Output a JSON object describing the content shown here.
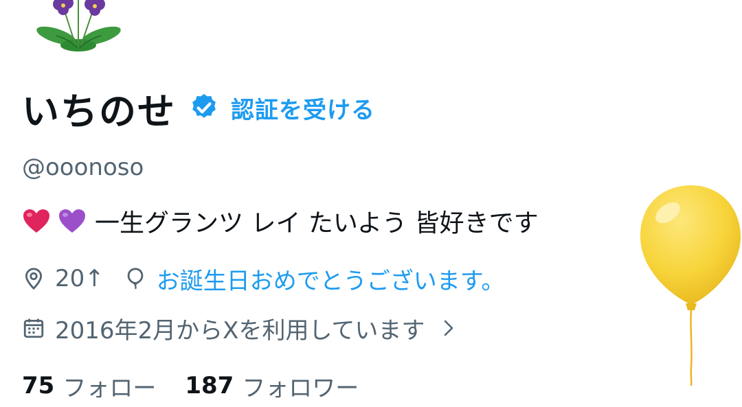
{
  "profile": {
    "display_name": "いちのせ",
    "get_verified_label": "認証を受ける",
    "handle": "@ooonoso",
    "bio_text": "一生グランツ レイ たいよう 皆好きです",
    "bio_emojis": [
      "red-heart",
      "purple-heart"
    ],
    "location": "20↑",
    "birthday_text": "お誕生日おめでとうございます。",
    "joined": "2016年2月からXを利用しています",
    "following_count": "75",
    "following_label": "フォロー",
    "followers_count": "187",
    "followers_label": "フォロワー"
  },
  "icons": {
    "avatar": "violet-flower-illustration",
    "verified": "verified-badge-icon",
    "location": "location-pin-icon",
    "birthday": "balloon-outline-icon",
    "calendar": "calendar-icon",
    "chevron": "chevron-right-icon",
    "decoration": "yellow-balloon"
  },
  "colors": {
    "text_primary": "#0f1419",
    "text_secondary": "#536471",
    "accent": "#1d9bf0",
    "balloon": "#f7d43a"
  }
}
